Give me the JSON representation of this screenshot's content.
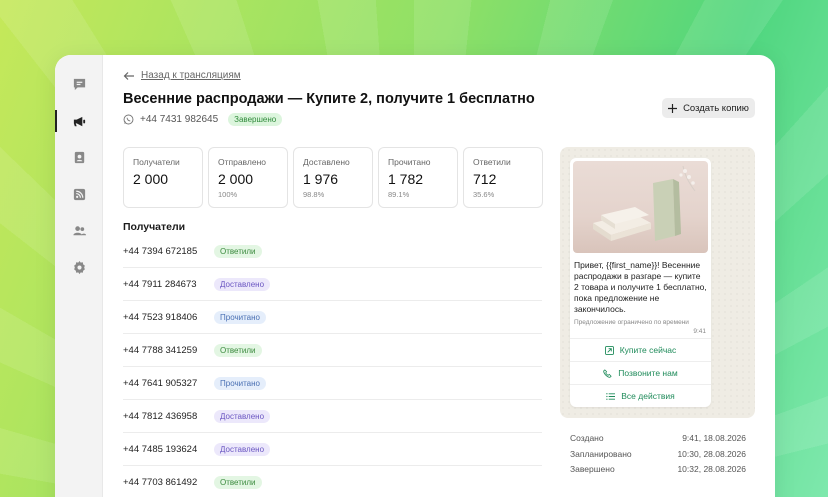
{
  "nav": {
    "items": [
      {
        "name": "chat-icon"
      },
      {
        "name": "megaphone-icon",
        "active": true
      },
      {
        "name": "contacts-icon"
      },
      {
        "name": "rss-icon"
      },
      {
        "name": "users-icon"
      },
      {
        "name": "gear-icon"
      }
    ]
  },
  "header": {
    "back_label": "Назад к трансляциям",
    "title": "Весенние распродажи — Купите 2, получите 1 бесплатно",
    "phone": "+44 7431 982645",
    "status": "Завершено",
    "copy_label": "Создать копию"
  },
  "stats": [
    {
      "label": "Получатели",
      "value": "2 000",
      "pct": ""
    },
    {
      "label": "Отправлено",
      "value": "2 000",
      "pct": "100%"
    },
    {
      "label": "Доставлено",
      "value": "1 976",
      "pct": "98.8%"
    },
    {
      "label": "Прочитано",
      "value": "1 782",
      "pct": "89.1%"
    },
    {
      "label": "Ответили",
      "value": "712",
      "pct": "35.6%"
    }
  ],
  "recipients": {
    "title": "Получатели",
    "rows": [
      {
        "phone": "+44 7394 672185",
        "status": "Ответили",
        "kind": "ans"
      },
      {
        "phone": "+44 7911 284673",
        "status": "Доставлено",
        "kind": "deliv"
      },
      {
        "phone": "+44 7523 918406",
        "status": "Прочитано",
        "kind": "read"
      },
      {
        "phone": "+44 7788 341259",
        "status": "Ответили",
        "kind": "ans"
      },
      {
        "phone": "+44 7641 905327",
        "status": "Прочитано",
        "kind": "read"
      },
      {
        "phone": "+44 7812 436958",
        "status": "Доставлено",
        "kind": "deliv"
      },
      {
        "phone": "+44 7485 193624",
        "status": "Доставлено",
        "kind": "deliv"
      },
      {
        "phone": "+44 7703 861492",
        "status": "Ответили",
        "kind": "ans"
      }
    ]
  },
  "preview": {
    "text": "Привет, {{first_name}}! Весенние распродажи в разгаре — купите 2 товара и получите 1 бесплатно, пока предложение не закончилось.",
    "footer": "Предложение ограничено по времени",
    "time": "9:41",
    "actions": [
      {
        "label": "Купите сейчас",
        "icon": "external-link-icon"
      },
      {
        "label": "Позвоните нам",
        "icon": "phone-icon"
      },
      {
        "label": "Все действия",
        "icon": "list-icon"
      }
    ]
  },
  "timeline": [
    {
      "label": "Создано",
      "value": "9:41, 18.08.2026"
    },
    {
      "label": "Запланировано",
      "value": "10:30, 28.08.2026"
    },
    {
      "label": "Завершено",
      "value": "10:32, 28.08.2026"
    }
  ],
  "colors": {
    "accent": "#1f8b5a",
    "done_badge": "#dcf5dd"
  }
}
